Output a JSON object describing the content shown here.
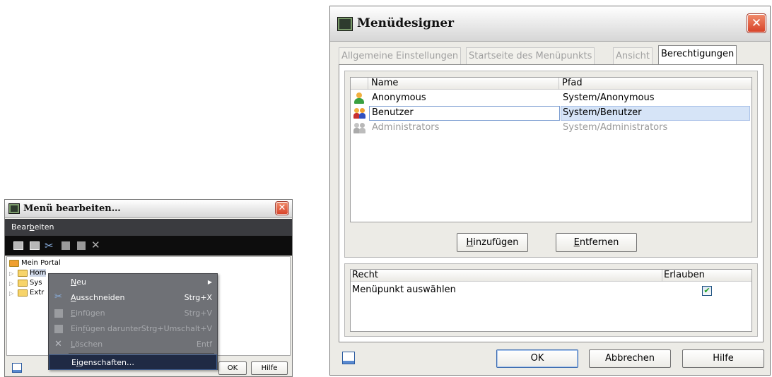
{
  "small_window": {
    "title": "Menü bearbeiten…",
    "menubar": {
      "label_before": "Bear",
      "label_hotkey": "b",
      "label_after": "eiten"
    },
    "toolbar_icons": [
      "add-item-icon",
      "add-subitem-icon",
      "cut-icon",
      "paste-icon",
      "paste-below-icon",
      "delete-icon"
    ],
    "tree": {
      "root": "Mein Portal",
      "children": [
        "Hom",
        "Sys",
        "Extr"
      ]
    },
    "context_menu": {
      "items": [
        {
          "hotkey": "N",
          "rest": "eu",
          "shortcut": "",
          "enabled": true,
          "submenu": true,
          "icon": ""
        },
        {
          "hotkey": "A",
          "rest": "usschneiden",
          "shortcut": "Strg+X",
          "enabled": true,
          "submenu": false,
          "icon": "cut-icon"
        },
        {
          "hotkey": "E",
          "rest": "infügen",
          "shortcut": "Strg+V",
          "enabled": false,
          "submenu": false,
          "icon": "paste-icon"
        },
        {
          "hotkey": "",
          "label": "Einfügen darunter",
          "pre": "Ein",
          "mid": "f",
          "post": "ügen darunter",
          "shortcut": "Strg+Umschalt+V",
          "enabled": false,
          "submenu": false,
          "icon": "paste-below-icon"
        },
        {
          "hotkey": "L",
          "rest": "öschen",
          "shortcut": "Entf",
          "enabled": false,
          "submenu": false,
          "icon": "delete-icon"
        },
        {
          "hotkey": "",
          "pre": "E",
          "mid": "i",
          "post": "genschaften…",
          "shortcut": "",
          "enabled": true,
          "submenu": false,
          "icon": "",
          "highlighted": true
        }
      ]
    },
    "ok_label": "OK",
    "help_label": "Hilfe"
  },
  "main_window": {
    "title": "Menüdesigner",
    "tabs": [
      {
        "label": "Allgemeine Einstellungen",
        "active": false
      },
      {
        "label": "Startseite des Menüpunkts",
        "active": false
      },
      {
        "label": "Ansicht",
        "active": false
      },
      {
        "label": "Berechtigungen",
        "active": true
      }
    ],
    "users_table": {
      "columns": [
        "Name",
        "Pfad"
      ],
      "rows": [
        {
          "name": "Anonymous",
          "path": "System/Anonymous",
          "icon": "user-icon",
          "state": "normal"
        },
        {
          "name": "Benutzer",
          "path": "System/Benutzer",
          "icon": "group-icon",
          "state": "selected"
        },
        {
          "name": "Administrators",
          "path": "System/Administrators",
          "icon": "group-disabled-icon",
          "state": "disabled"
        }
      ]
    },
    "add_button": {
      "hotkey": "H",
      "rest": "inzufügen"
    },
    "remove_button": {
      "hotkey": "E",
      "rest": "ntfernen"
    },
    "rights_table": {
      "columns": [
        "Recht",
        "Erlauben"
      ],
      "rows": [
        {
          "label": "Menüpunkt auswählen",
          "allowed": true
        }
      ]
    },
    "ok_label": "OK",
    "cancel_label": "Abbrechen",
    "help_label": "Hilfe"
  },
  "colors": {
    "selection_blue": "#d6e4f7",
    "context_menu_bg": "#6f7176",
    "toolbar_bg": "#0d0d0d",
    "menubar_bg": "#3a3b3f",
    "close_red": "#d8442a"
  }
}
